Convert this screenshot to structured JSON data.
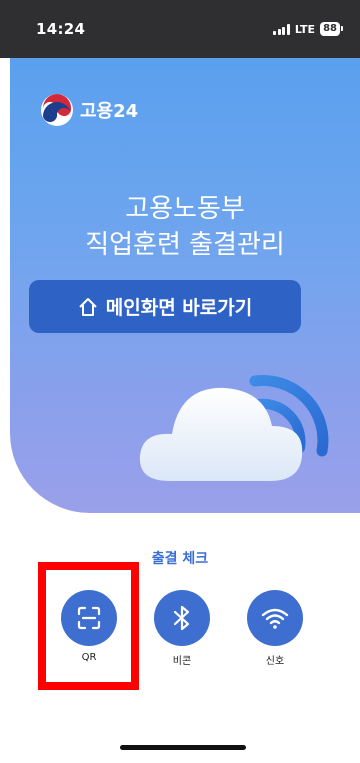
{
  "status_bar": {
    "time": "14:24",
    "network": "LTE",
    "battery": "88"
  },
  "hero": {
    "brand_name": "고용24",
    "title_line1": "고용노동부",
    "title_line2": "직업훈련 출결관리",
    "main_button_label": "메인화면 바로가기"
  },
  "attendance": {
    "title": "출결 체크",
    "options": [
      {
        "label": "QR",
        "icon": "qr-scan-icon"
      },
      {
        "label": "비콘",
        "icon": "bluetooth-icon"
      },
      {
        "label": "신호",
        "icon": "wifi-icon"
      }
    ]
  },
  "colors": {
    "hero_gradient_top": "#5aa0ee",
    "hero_gradient_bottom": "#9aa0ea",
    "button_blue": "#2f62c5",
    "check_circle_blue": "#3e6fd0",
    "check_title_blue": "#3a6fd6",
    "highlight_red": "#ff0000"
  }
}
